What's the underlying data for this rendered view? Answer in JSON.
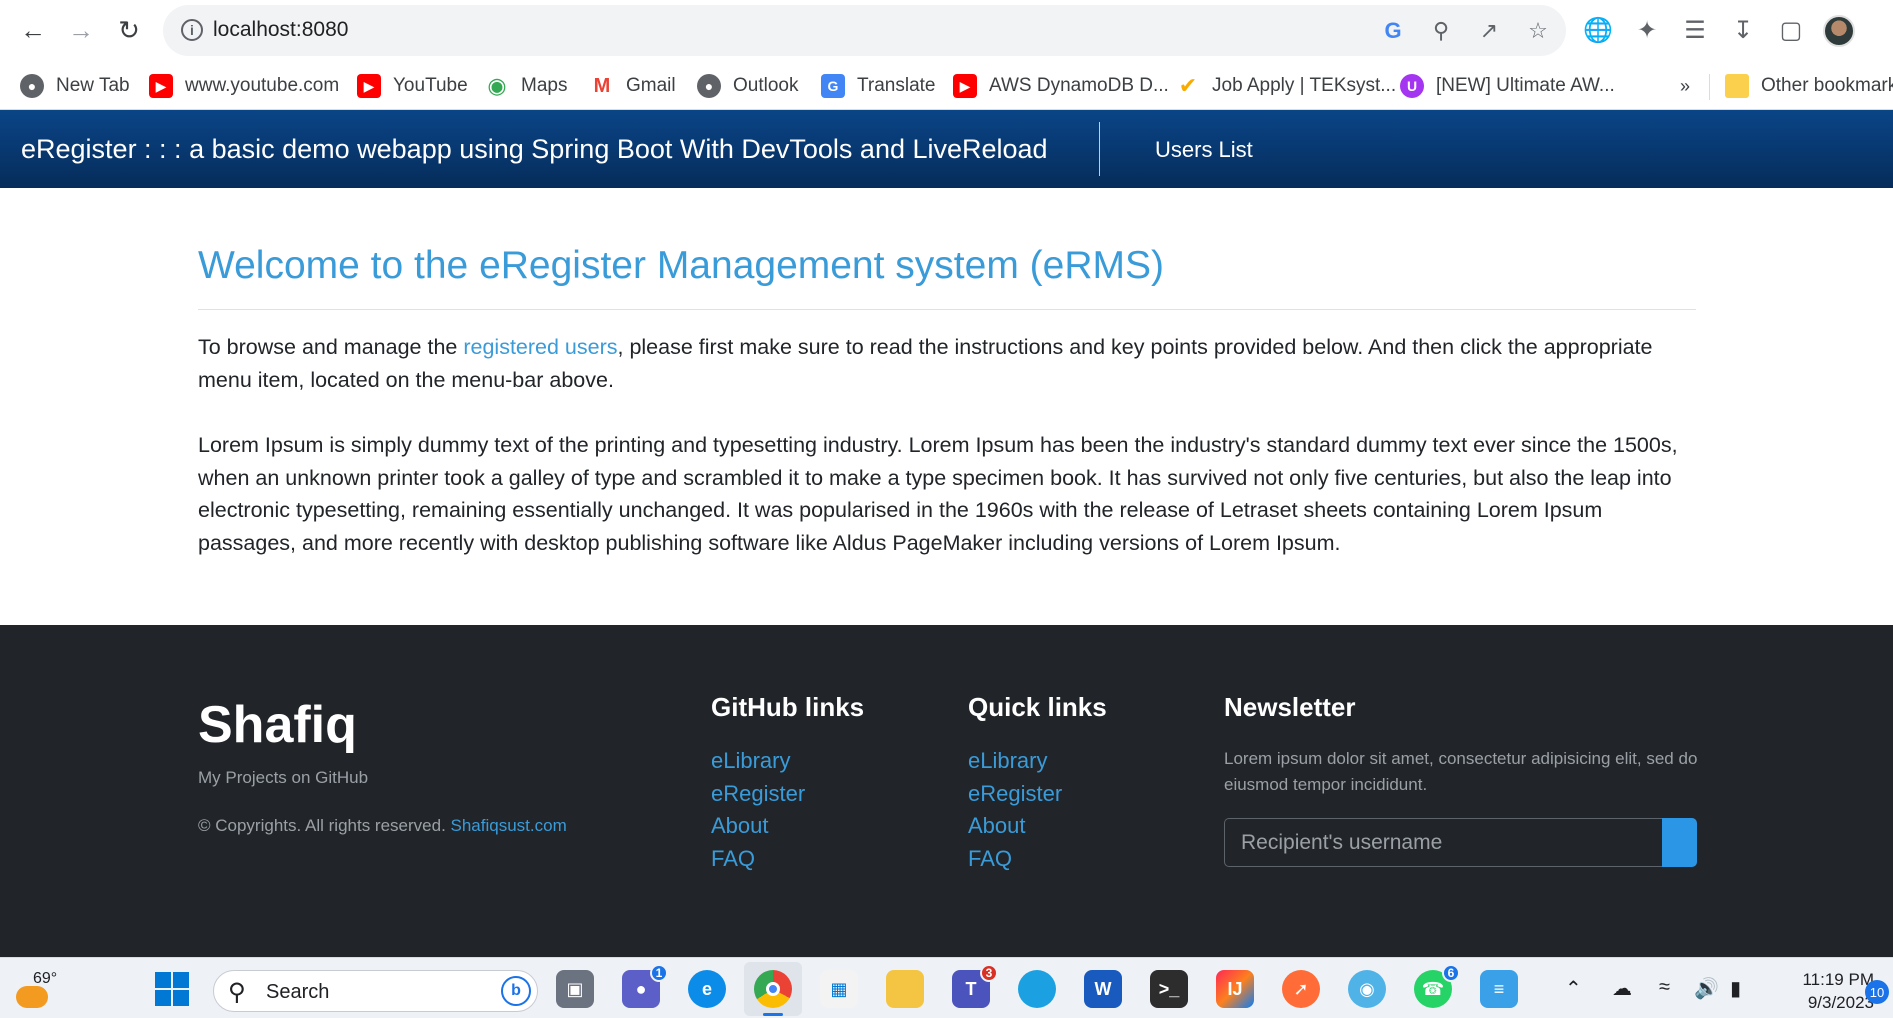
{
  "browser": {
    "url": "localhost:8080",
    "bookmarks": [
      {
        "label": "New Tab",
        "icon": "globe-icon",
        "color": "#5f6368"
      },
      {
        "label": "www.youtube.com",
        "icon": "youtube-icon",
        "color": "#ff0000"
      },
      {
        "label": "YouTube",
        "icon": "youtube-icon",
        "color": "#ff0000"
      },
      {
        "label": "Maps",
        "icon": "maps-pin-icon",
        "color": "#34a853"
      },
      {
        "label": "Gmail",
        "icon": "gmail-icon",
        "color": "#ea4335"
      },
      {
        "label": "Outlook",
        "icon": "globe-icon",
        "color": "#5f6368"
      },
      {
        "label": "Translate",
        "icon": "translate-icon",
        "color": "#4285f4"
      },
      {
        "label": "AWS DynamoDB D...",
        "icon": "youtube-icon",
        "color": "#ff0000"
      },
      {
        "label": "Job Apply | TEKsyst...",
        "icon": "teksystems-icon",
        "color": "#f9ab00"
      },
      {
        "label": "[NEW] Ultimate AW...",
        "icon": "udemy-icon",
        "color": "#a435f0"
      }
    ],
    "overflow_label": "»",
    "other_bookmarks": "Other bookmarks"
  },
  "app": {
    "brand": "eRegister : : : a basic demo webapp using Spring Boot With DevTools and LiveReload",
    "nav_link": "Users List"
  },
  "main": {
    "title": "Welcome to the eRegister Management system (eRMS)",
    "intro_before": "To browse and manage the ",
    "intro_link": "registered users",
    "intro_after": ", please first make sure to read the instructions and key points provided below. And then click the appropriate menu item, located on the menu-bar above.",
    "lorem": "Lorem Ipsum is simply dummy text of the printing and typesetting industry. Lorem Ipsum has been the industry's standard dummy text ever since the 1500s, when an unknown printer took a galley of type and scrambled it to make a type specimen book. It has survived not only five centuries, but also the leap into electronic typesetting, remaining essentially unchanged. It was popularised in the 1960s with the release of Letraset sheets containing Lorem Ipsum passages, and more recently with desktop publishing software like Aldus PageMaker including versions of Lorem Ipsum."
  },
  "footer": {
    "brand": "Shafiq",
    "subtitle": "My Projects on GitHub",
    "copyright_text": "© Copyrights. All rights reserved. ",
    "copyright_link": "Shafiqsust.com",
    "github": {
      "heading": "GitHub links",
      "links": [
        "eLibrary",
        "eRegister",
        "About",
        "FAQ"
      ]
    },
    "quick": {
      "heading": "Quick links",
      "links": [
        "eLibrary",
        "eRegister",
        "About",
        "FAQ"
      ]
    },
    "newsletter": {
      "heading": "Newsletter",
      "text": "Lorem ipsum dolor sit amet, consectetur adipisicing elit, sed do eiusmod tempor incididunt.",
      "placeholder": "Recipient's username"
    }
  },
  "taskbar": {
    "weather": "69°",
    "search_label": "Search",
    "badges": {
      "teams_chat": "1",
      "teams": "3",
      "whatsapp": "6"
    },
    "time": "11:19 PM",
    "date": "9/3/2023",
    "notifications": "10"
  },
  "colors": {
    "accent": "#3a9bd9",
    "navbar": "#0a4587",
    "footer": "#212529"
  }
}
